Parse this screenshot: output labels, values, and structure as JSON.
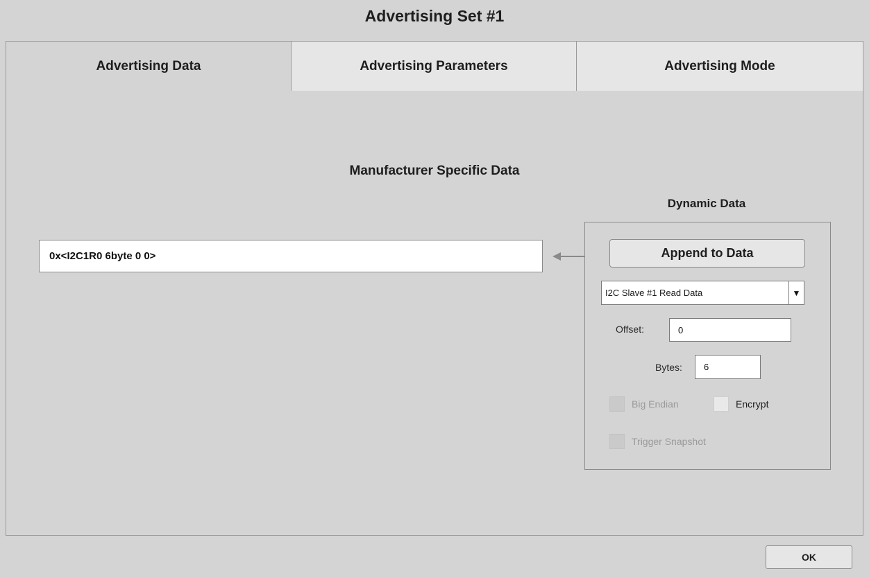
{
  "window": {
    "title": "Advertising Set #1"
  },
  "tabs": [
    {
      "label": "Advertising Data",
      "active": true
    },
    {
      "label": "Advertising Parameters",
      "active": false
    },
    {
      "label": "Advertising Mode",
      "active": false
    }
  ],
  "section": {
    "title": "Manufacturer Specific Data"
  },
  "data_field": {
    "value": "0x<I2C1R0 6byte 0 0>"
  },
  "arrow_icon": "left-arrow-icon",
  "dynamic_data": {
    "title": "Dynamic Data",
    "append_label": "Append to Data",
    "source_select": {
      "value": "I2C Slave #1 Read Data",
      "arrow_icon": "dropdown-arrow-icon"
    },
    "offset": {
      "label": "Offset:",
      "value": "0"
    },
    "bytes": {
      "label": "Bytes:",
      "value": "6"
    },
    "big_endian": {
      "label": "Big Endian",
      "checked": false,
      "enabled": false
    },
    "encrypt": {
      "label": "Encrypt",
      "checked": false,
      "enabled": true
    },
    "trigger_snapshot": {
      "label": "Trigger Snapshot",
      "checked": false,
      "enabled": false
    }
  },
  "footer": {
    "ok_label": "OK"
  }
}
